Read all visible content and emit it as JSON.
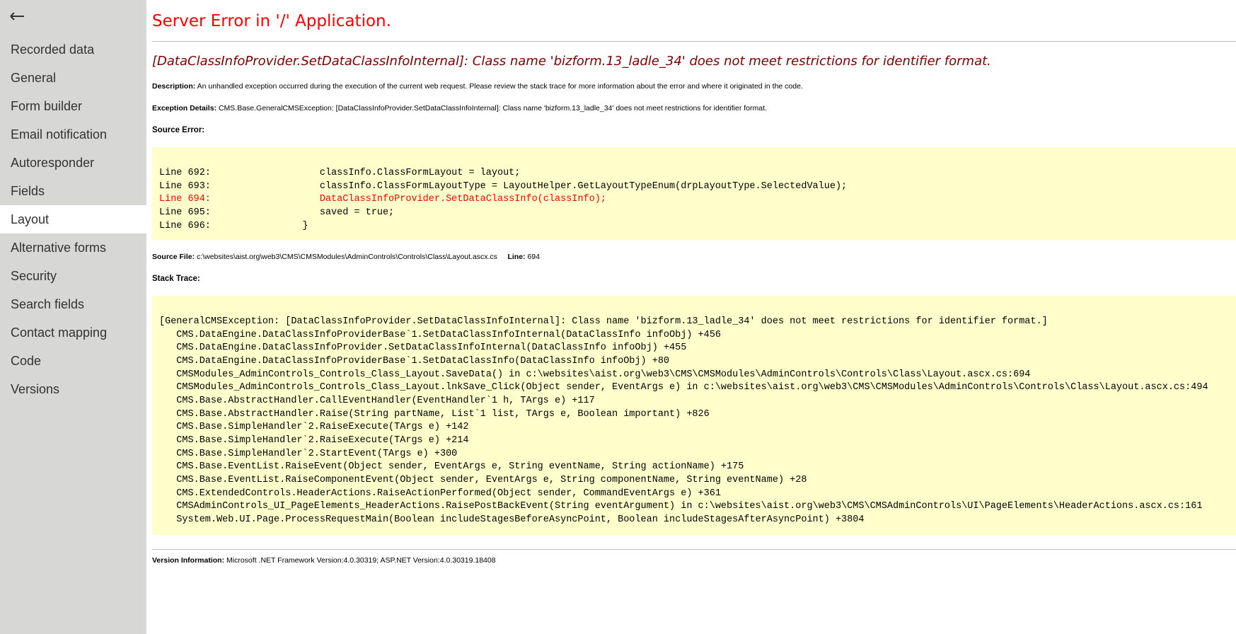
{
  "sidebar": {
    "back_icon": "arrow-left-icon",
    "items": [
      {
        "label": "Recorded data",
        "active": false
      },
      {
        "label": "General",
        "active": false
      },
      {
        "label": "Form builder",
        "active": false
      },
      {
        "label": "Email notification",
        "active": false
      },
      {
        "label": "Autoresponder",
        "active": false
      },
      {
        "label": "Fields",
        "active": false
      },
      {
        "label": "Layout",
        "active": true
      },
      {
        "label": "Alternative forms",
        "active": false
      },
      {
        "label": "Security",
        "active": false
      },
      {
        "label": "Search fields",
        "active": false
      },
      {
        "label": "Contact mapping",
        "active": false
      },
      {
        "label": "Code",
        "active": false
      },
      {
        "label": "Versions",
        "active": false
      }
    ]
  },
  "error": {
    "title": "Server Error in '/' Application.",
    "subtitle": "[DataClassInfoProvider.SetDataClassInfoInternal]: Class name 'bizform.13_ladle_34' does not meet restrictions for identifier format.",
    "description_label": "Description:",
    "description": "An unhandled exception occurred during the execution of the current web request. Please review the stack trace for more information about the error and where it originated in the code.",
    "exception_label": "Exception Details:",
    "exception": "CMS.Base.GeneralCMSException: [DataClassInfoProvider.SetDataClassInfoInternal]: Class name 'bizform.13_ladle_34' does not meet restrictions for identifier format.",
    "source_error_label": "Source Error:",
    "source_lines": [
      "Line 692:                   classInfo.ClassFormLayout = layout;",
      "Line 693:                   classInfo.ClassFormLayoutType = LayoutHelper.GetLayoutTypeEnum(drpLayoutType.SelectedValue);",
      "Line 694:                   DataClassInfoProvider.SetDataClassInfo(classInfo);",
      "Line 695:                   saved = true;",
      "Line 696:                }"
    ],
    "error_line_index": 2,
    "source_file_label": "Source File:",
    "source_file": "c:\\websites\\aist.org\\web3\\CMS\\CMSModules\\AdminControls\\Controls\\Class\\Layout.ascx.cs",
    "line_label": "Line:",
    "line_number": "694",
    "stack_trace_label": "Stack Trace:",
    "stack_lines": [
      "[GeneralCMSException: [DataClassInfoProvider.SetDataClassInfoInternal]: Class name 'bizform.13_ladle_34' does not meet restrictions for identifier format.]",
      "   CMS.DataEngine.DataClassInfoProviderBase`1.SetDataClassInfoInternal(DataClassInfo infoObj) +456",
      "   CMS.DataEngine.DataClassInfoProvider.SetDataClassInfoInternal(DataClassInfo infoObj) +455",
      "   CMS.DataEngine.DataClassInfoProviderBase`1.SetDataClassInfo(DataClassInfo infoObj) +80",
      "   CMSModules_AdminControls_Controls_Class_Layout.SaveData() in c:\\websites\\aist.org\\web3\\CMS\\CMSModules\\AdminControls\\Controls\\Class\\Layout.ascx.cs:694",
      "   CMSModules_AdminControls_Controls_Class_Layout.lnkSave_Click(Object sender, EventArgs e) in c:\\websites\\aist.org\\web3\\CMS\\CMSModules\\AdminControls\\Controls\\Class\\Layout.ascx.cs:494",
      "   CMS.Base.AbstractHandler.CallEventHandler(EventHandler`1 h, TArgs e) +117",
      "   CMS.Base.AbstractHandler.Raise(String partName, List`1 list, TArgs e, Boolean important) +826",
      "   CMS.Base.SimpleHandler`2.RaiseExecute(TArgs e) +142",
      "   CMS.Base.SimpleHandler`2.RaiseExecute(TArgs e) +214",
      "   CMS.Base.SimpleHandler`2.StartEvent(TArgs e) +300",
      "   CMS.Base.EventList.RaiseEvent(Object sender, EventArgs e, String eventName, String actionName) +175",
      "   CMS.Base.EventList.RaiseComponentEvent(Object sender, EventArgs e, String componentName, String eventName) +28",
      "   CMS.ExtendedControls.HeaderActions.RaiseActionPerformed(Object sender, CommandEventArgs e) +361",
      "   CMSAdminControls_UI_PageElements_HeaderActions.RaisePostBackEvent(String eventArgument) in c:\\websites\\aist.org\\web3\\CMS\\CMSAdminControls\\UI\\PageElements\\HeaderActions.ascx.cs:161",
      "   System.Web.UI.Page.ProcessRequestMain(Boolean includeStagesBeforeAsyncPoint, Boolean includeStagesAfterAsyncPoint) +3804"
    ],
    "version_label": "Version Information:",
    "version": "Microsoft .NET Framework Version:4.0.30319; ASP.NET Version:4.0.30319.18408"
  },
  "colors": {
    "sidebar_bg": "#d7d8d5",
    "title": "#ff0000",
    "subtitle": "#800000",
    "code_bg": "#ffffcc",
    "error_line": "#ff0000"
  }
}
